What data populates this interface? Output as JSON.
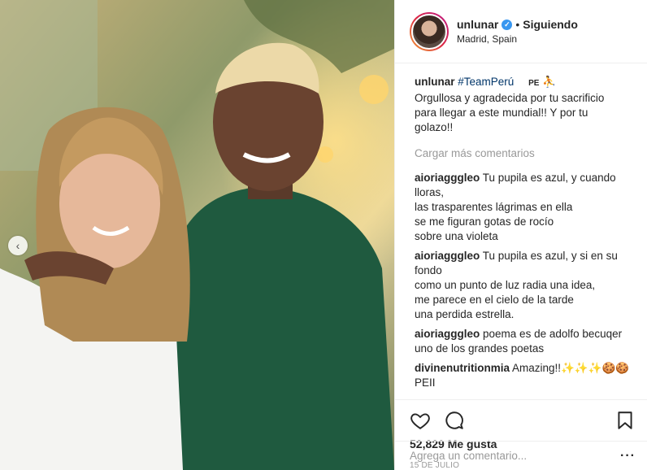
{
  "post": {
    "username": "unlunar",
    "follow_label": "Siguiendo",
    "separator": "•",
    "location": "Madrid, Spain",
    "verified_glyph": "✓"
  },
  "caption": {
    "username": "unlunar",
    "hashtag": "#TeamPerú",
    "flag_text": "PE",
    "emoji": "⛹",
    "lines": [
      "Orgullosa y agradecida por tu sacrificio",
      "para llegar a este mundial!! Y por tu",
      "golazo!!"
    ]
  },
  "load_more_label": "Cargar más comentarios",
  "comments": [
    {
      "username": "aioriagggleo",
      "first": "Tu pupila es azul, y cuando",
      "lines": [
        "lloras,",
        "las trasparentes lágrimas en ella",
        "se me figuran gotas de rocío",
        "sobre una violeta"
      ]
    },
    {
      "username": "aioriagggleo",
      "first": "Tu pupila es azul, y si en su",
      "lines": [
        "fondo",
        "como un punto de luz radia una idea,",
        "me parece en el cielo de la tarde",
        "una perdida estrella."
      ]
    },
    {
      "username": "aioriagggleo",
      "first": "poema es de adolfo becuqer",
      "lines": [
        "uno de los grandes poetas"
      ]
    },
    {
      "username": "divinenutritionmia",
      "first": "Amazing!!✨✨✨🍪🍪",
      "lines": [
        "PEII"
      ]
    }
  ],
  "likes_text": "52,829 Me gusta",
  "date_text": "15 DE JULIO",
  "add_comment_placeholder": "Agrega un comentario...",
  "icons": {
    "heart": "heart-icon",
    "comment": "comment-icon",
    "bookmark": "bookmark-icon",
    "prev": "chevron-left-icon"
  },
  "colors": {
    "link_blue": "#003569",
    "verified_blue": "#3897f0",
    "muted": "#999999",
    "text": "#262626"
  }
}
